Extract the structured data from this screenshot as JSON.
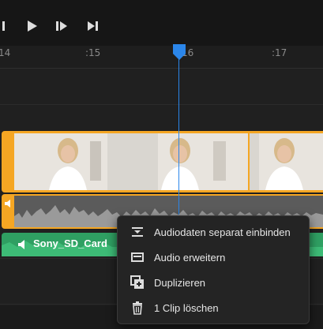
{
  "ruler": {
    "ticks": [
      "14",
      ":15",
      ":16",
      ":17"
    ]
  },
  "audio_track": {
    "label": "Sony_SD_Card"
  },
  "context_menu": {
    "items": [
      {
        "label": "Audiodaten separat einbinden",
        "icon": "detach-audio-icon"
      },
      {
        "label": "Audio erweitern",
        "icon": "expand-audio-icon"
      },
      {
        "label": "Duplizieren",
        "icon": "duplicate-icon"
      },
      {
        "label": "1 Clip löschen",
        "icon": "trash-icon"
      }
    ]
  },
  "colors": {
    "accent": "#f5a623",
    "playhead": "#2b86ea",
    "audio_green": "#2f9f62"
  }
}
